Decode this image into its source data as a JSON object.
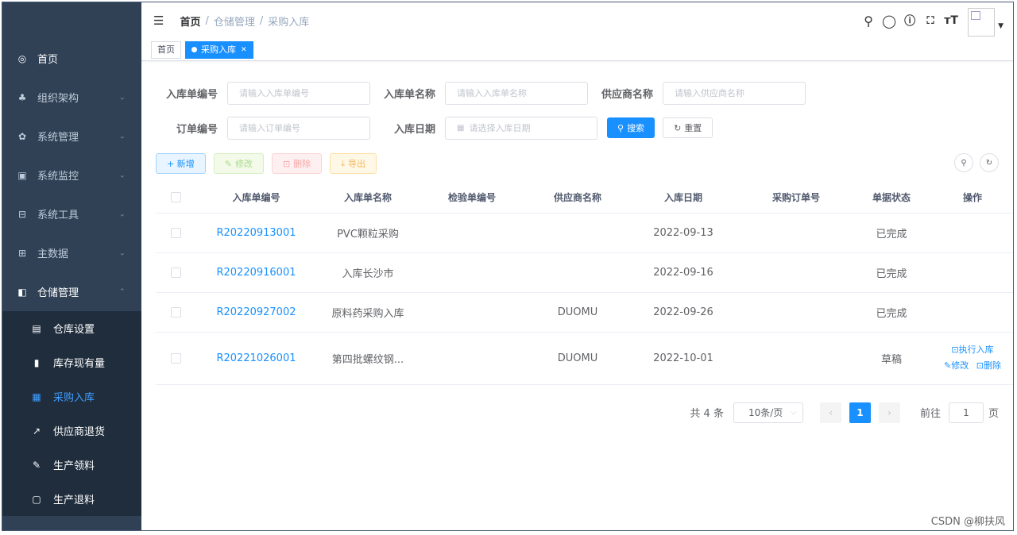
{
  "sidebar": {
    "items": [
      {
        "label": "首页",
        "icon": "dashboard-icon",
        "glyph": "◎",
        "has_arrow": false
      },
      {
        "label": "组织架构",
        "icon": "tree-icon",
        "glyph": "♣",
        "has_arrow": true
      },
      {
        "label": "系统管理",
        "icon": "gear-icon",
        "glyph": "✿",
        "has_arrow": true
      },
      {
        "label": "系统监控",
        "icon": "monitor-icon",
        "glyph": "▣",
        "has_arrow": true
      },
      {
        "label": "系统工具",
        "icon": "toolbox-icon",
        "glyph": "⊟",
        "has_arrow": true
      },
      {
        "label": "主数据",
        "icon": "grid-icon",
        "glyph": "⊞",
        "has_arrow": true
      },
      {
        "label": "仓储管理",
        "icon": "warehouse-icon",
        "glyph": "◧",
        "has_arrow": true
      }
    ],
    "subitems": [
      {
        "label": "仓库设置",
        "icon": "warehouse-setting-icon",
        "glyph": "▤"
      },
      {
        "label": "库存现有量",
        "icon": "bar-chart-icon",
        "glyph": "▮"
      },
      {
        "label": "采购入库",
        "icon": "stock-in-icon",
        "glyph": "▦"
      },
      {
        "label": "供应商退货",
        "icon": "return-icon",
        "glyph": "↗"
      },
      {
        "label": "生产领料",
        "icon": "edit-icon",
        "glyph": "✎"
      },
      {
        "label": "生产退料",
        "icon": "picture-icon",
        "glyph": "▢"
      }
    ]
  },
  "navbar": {
    "breadcrumb": [
      "首页",
      "仓储管理",
      "采购入库"
    ]
  },
  "tags": [
    "首页",
    "采购入库"
  ],
  "search": {
    "fields": [
      {
        "label": "入库单编号",
        "placeholder": "请输入入库单编号"
      },
      {
        "label": "入库单名称",
        "placeholder": "请输入入库单名称"
      },
      {
        "label": "供应商名称",
        "placeholder": "请输入供应商名称"
      },
      {
        "label": "订单编号",
        "placeholder": "请输入订单编号"
      },
      {
        "label": "入库日期",
        "placeholder": "请选择入库日期"
      }
    ],
    "search_label": "搜索",
    "reset_label": "重置"
  },
  "toolbar": {
    "add": "+ 新增",
    "edit": "修改",
    "delete": "删除",
    "export": "导出"
  },
  "table": {
    "headers": [
      "入库单编号",
      "入库单名称",
      "检验单编号",
      "供应商名称",
      "入库日期",
      "采购订单号",
      "单据状态",
      "操作"
    ],
    "rows": [
      {
        "code": "R20220913001",
        "name": "PVC颗粒采购",
        "inspect": "",
        "vendor": "",
        "date": "2022-09-13",
        "po": "",
        "status": "已完成"
      },
      {
        "code": "R20220916001",
        "name": "入库长沙市",
        "inspect": "",
        "vendor": "",
        "date": "2022-09-16",
        "po": "",
        "status": "已完成"
      },
      {
        "code": "R20220927002",
        "name": "原料药采购入库",
        "inspect": "",
        "vendor": "DUOMU",
        "date": "2022-09-26",
        "po": "",
        "status": "已完成"
      },
      {
        "code": "R20221026001",
        "name": "第四批螺纹钢...",
        "inspect": "",
        "vendor": "DUOMU",
        "date": "2022-10-01",
        "po": "",
        "status": "草稿"
      }
    ],
    "ops": {
      "execute": "执行入库",
      "edit": "修改",
      "delete": "删除"
    }
  },
  "pager": {
    "total": "共 4 条",
    "page_size": "10条/页",
    "current": "1",
    "goto_prefix": "前往",
    "goto_value": "1",
    "goto_suffix": "页"
  },
  "watermark": "CSDN @柳扶风"
}
